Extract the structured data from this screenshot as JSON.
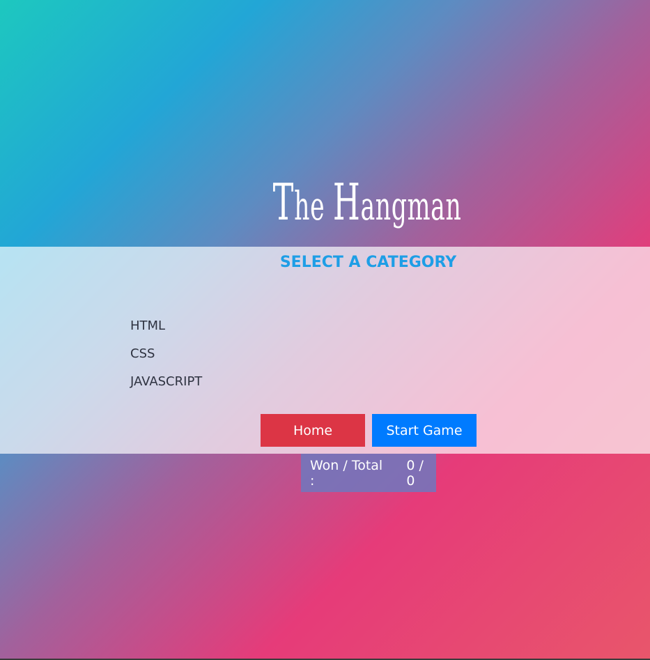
{
  "title": {
    "first": "T",
    "first_rest": "he ",
    "second": "H",
    "second_rest": "angman"
  },
  "panel": {
    "heading": "SELECT A CATEGORY",
    "categories": [
      "HTML",
      "CSS",
      "JAVASCRIPT"
    ]
  },
  "buttons": {
    "home": "Home",
    "start": "Start Game"
  },
  "score": {
    "label": "Won / Total :",
    "value": "0 / 0"
  },
  "colors": {
    "home_button": "#dc3545",
    "start_button": "#007bff",
    "heading": "#1e9ee6"
  }
}
